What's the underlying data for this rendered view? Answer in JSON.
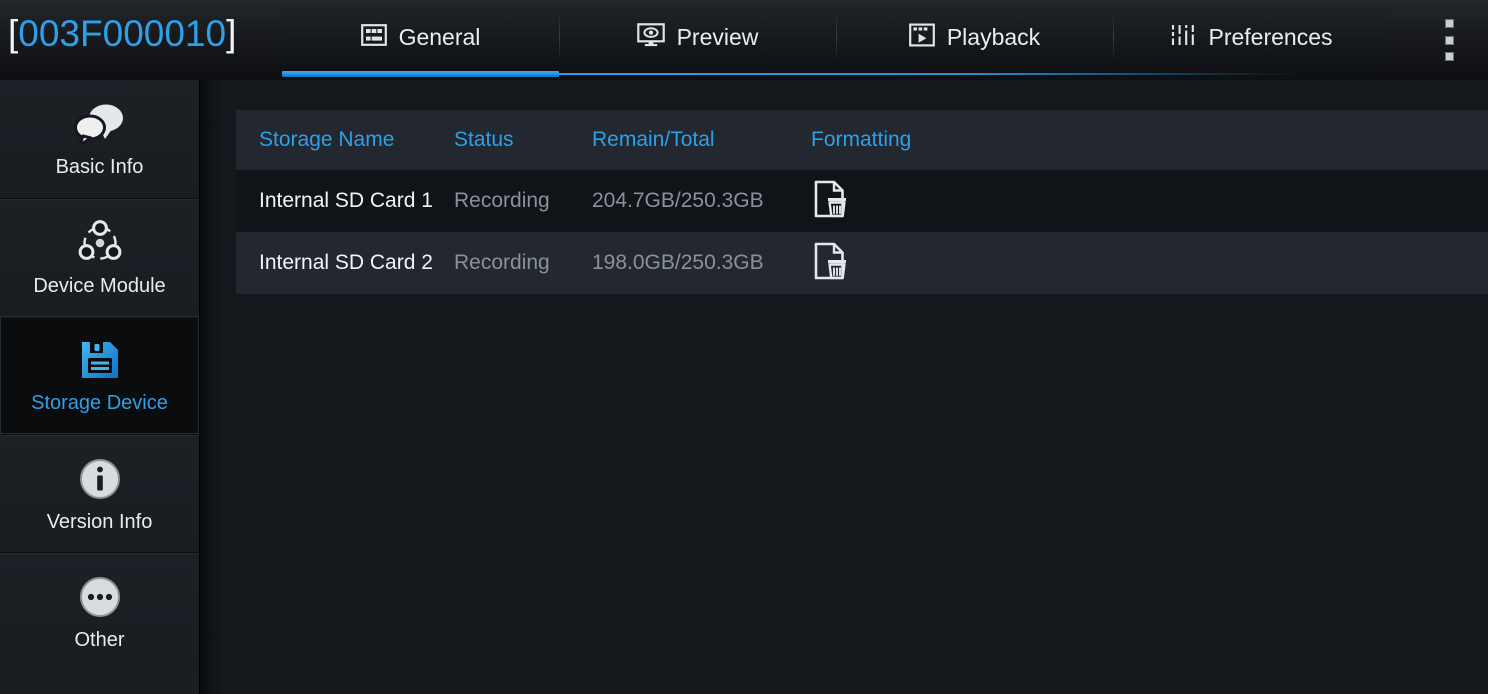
{
  "header": {
    "device_id_open_bracket": "[",
    "device_id": "003F000010",
    "device_id_close_bracket": "]",
    "accent_color": "#2f9fe8",
    "tabs": [
      {
        "label": "General",
        "icon": "grid-icon",
        "active": true
      },
      {
        "label": "Preview",
        "icon": "monitor-eye-icon",
        "active": false
      },
      {
        "label": "Playback",
        "icon": "film-play-icon",
        "active": false
      },
      {
        "label": "Preferences",
        "icon": "equalizer-icon",
        "active": false
      }
    ],
    "overflow_menu_icon": "more-vertical-icon"
  },
  "sidebar": {
    "items": [
      {
        "label": "Basic Info",
        "icon": "speech-bubbles-icon",
        "active": false
      },
      {
        "label": "Device Module",
        "icon": "network-nodes-icon",
        "active": false
      },
      {
        "label": "Storage Device",
        "icon": "floppy-disk-icon",
        "active": true
      },
      {
        "label": "Version Info",
        "icon": "info-circle-icon",
        "active": false
      },
      {
        "label": "Other",
        "icon": "ellipsis-circle-icon",
        "active": false
      }
    ]
  },
  "main": {
    "table": {
      "columns": [
        "Storage Name",
        "Status",
        "Remain/Total",
        "Formatting"
      ],
      "rows": [
        {
          "storage_name": "Internal SD Card 1",
          "status": "Recording",
          "remain_total": "204.7GB/250.3GB",
          "format_icon": "format-erase-icon"
        },
        {
          "storage_name": "Internal SD Card 2",
          "status": "Recording",
          "remain_total": "198.0GB/250.3GB",
          "format_icon": "format-erase-icon"
        }
      ]
    }
  }
}
